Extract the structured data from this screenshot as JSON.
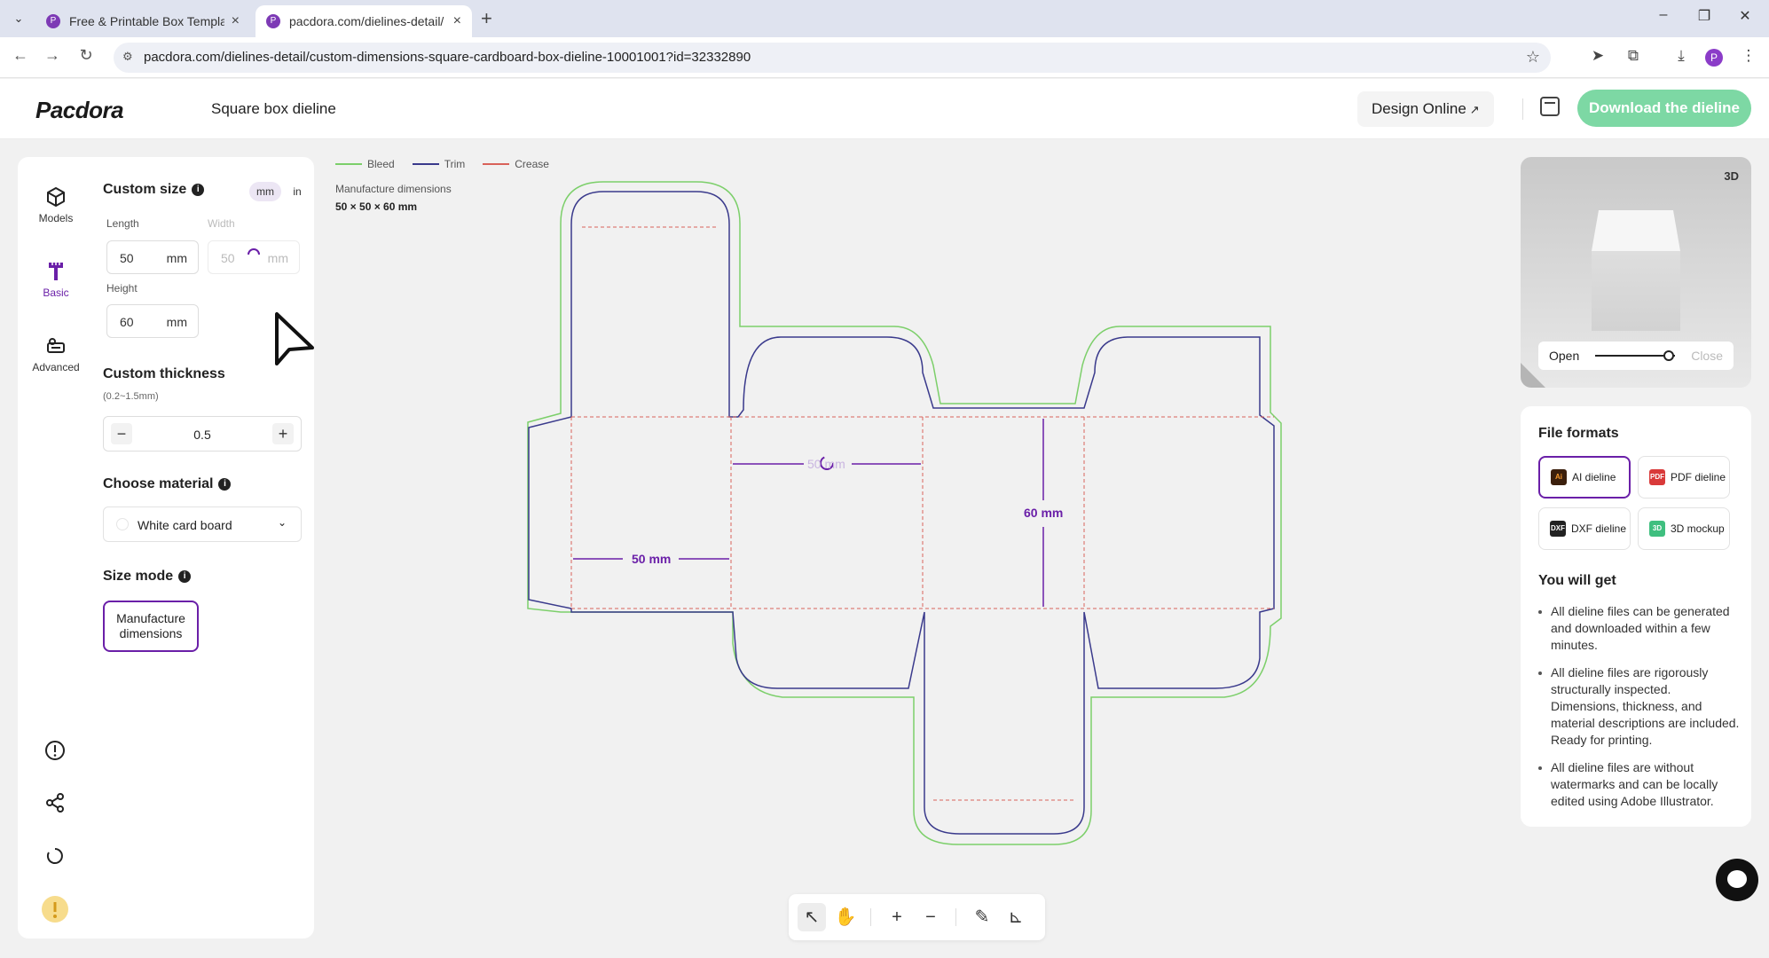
{
  "browser": {
    "tabs": [
      {
        "title": "Free & Printable Box Templat",
        "active": false
      },
      {
        "title": "pacdora.com/dielines-detail/",
        "active": true
      }
    ],
    "url": "pacdora.com/dielines-detail/custom-dimensions-square-cardboard-box-dieline-10001001?id=32332890"
  },
  "header": {
    "logo": "Pacdora",
    "page_title": "Square box dieline",
    "design_online": "Design Online",
    "download_label": "Download the dieline"
  },
  "nav": {
    "items": [
      {
        "label": "Models",
        "icon": "cube-icon"
      },
      {
        "label": "Basic",
        "icon": "ruler-icon"
      },
      {
        "label": "Advanced",
        "icon": "sliders-icon"
      }
    ]
  },
  "settings": {
    "custom_size_label": "Custom size",
    "units": [
      "mm",
      "in"
    ],
    "selected_unit": "mm",
    "length": {
      "label": "Length",
      "value": "50",
      "unit": "mm"
    },
    "width": {
      "label": "Width",
      "value": "50",
      "unit": "mm"
    },
    "height": {
      "label": "Height",
      "value": "60",
      "unit": "mm"
    },
    "thickness_label": "Custom thickness",
    "thickness_range": "(0.2~1.5mm)",
    "thickness_value": "0.5",
    "material_label": "Choose material",
    "material_value": "White card board",
    "size_mode_label": "Size mode",
    "size_mode_line1": "Manufacture",
    "size_mode_line2": "dimensions"
  },
  "canvas": {
    "legend": [
      {
        "label": "Bleed",
        "color": "#7ccf6a"
      },
      {
        "label": "Trim",
        "color": "#3a3a8c"
      },
      {
        "label": "Crease",
        "color": "#d9625a"
      }
    ],
    "mfg_label": "Manufacture dimensions",
    "mfg_value": "50 × 50 × 60 mm",
    "dim_length": "50 mm",
    "dim_width": "50 mm",
    "dim_height": "60 mm"
  },
  "preview": {
    "badge": "3D",
    "open_label": "Open",
    "close_label": "Close",
    "slider_position": 0.92
  },
  "formats": {
    "title": "File formats",
    "buttons": [
      {
        "label": "AI dieline",
        "badge": "Ai",
        "color": "#3b1f0c",
        "selected": true
      },
      {
        "label": "PDF dieline",
        "badge": "PDF",
        "color": "#d93a3a",
        "selected": false
      },
      {
        "label": "DXF dieline",
        "badge": "DXF",
        "color": "#222222",
        "selected": false
      },
      {
        "label": "3D mockup",
        "badge": "3D",
        "color": "#3fbf7f",
        "selected": false
      }
    ],
    "you_will_get": "You will get",
    "bullets": [
      "All dieline files can be generated and downloaded within a few minutes.",
      "All dieline files are rigorously structurally inspected. Dimensions, thickness, and material descriptions are included. Ready for printing.",
      "All dieline files are without watermarks and can be locally edited using Adobe Illustrator."
    ]
  }
}
